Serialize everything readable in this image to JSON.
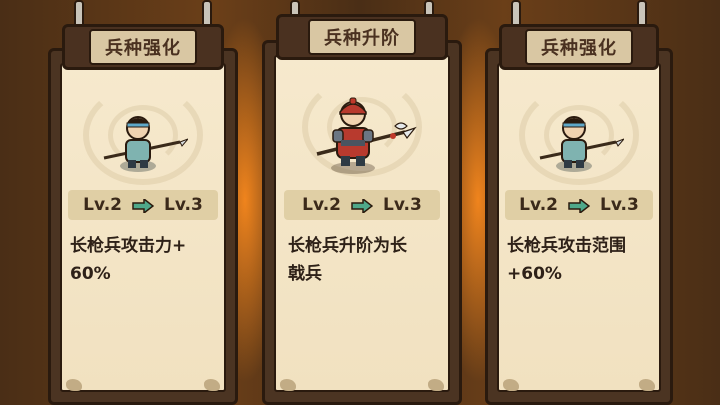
{
  "cards": [
    {
      "title": "兵种强化",
      "level_from": "Lv.2",
      "level_to": "Lv.3",
      "description": "长枪兵攻击力+\n60%",
      "unit_icon": "spearman-icon"
    },
    {
      "title": "兵种升阶",
      "level_from": "Lv.2",
      "level_to": "Lv.3",
      "description": "长枪兵升阶为长\n戟兵",
      "unit_icon": "halberdier-icon"
    },
    {
      "title": "兵种强化",
      "level_from": "Lv.2",
      "level_to": "Lv.3",
      "description": "长枪兵攻击范围\n+60%",
      "unit_icon": "spearman-icon"
    }
  ],
  "colors": {
    "arrow": "#4fa88a",
    "parchment": "#f3e4c5",
    "frame": "#4b3422",
    "glow": "#ff8c1e"
  }
}
